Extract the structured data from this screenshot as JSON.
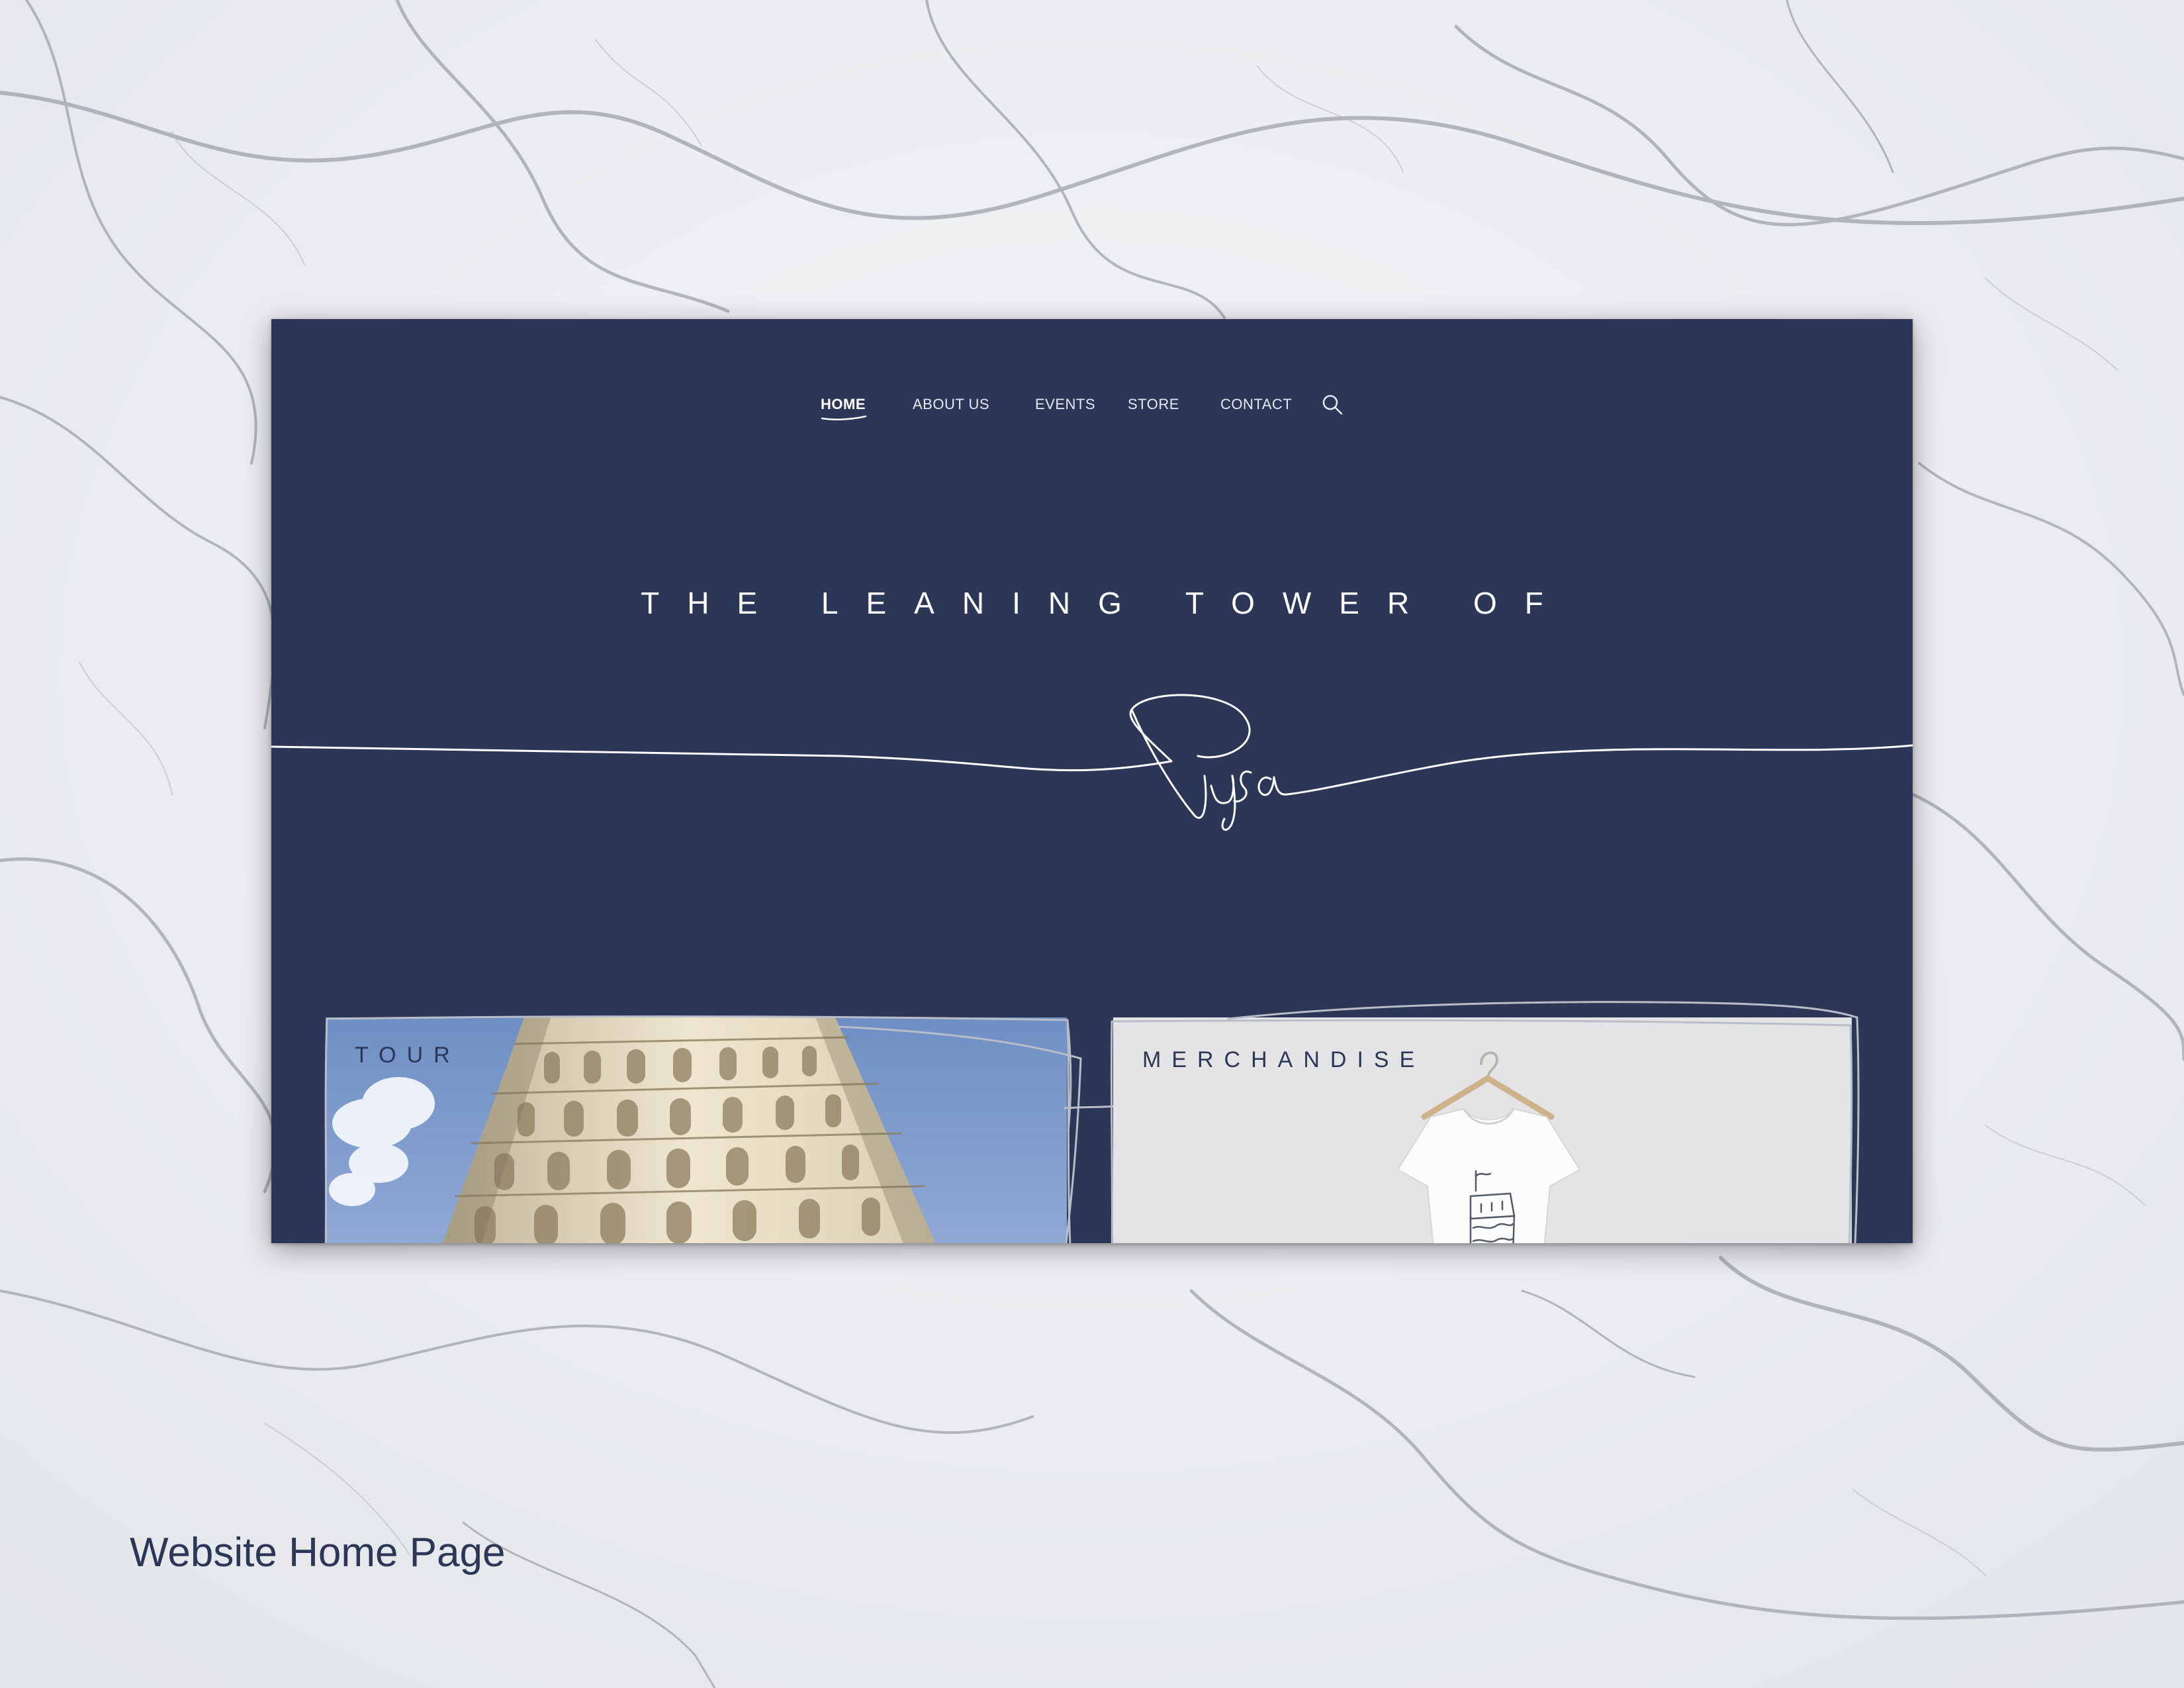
{
  "nav": {
    "items": [
      {
        "label": "HOME",
        "active": true
      },
      {
        "label": "ABOUT US",
        "active": false
      },
      {
        "label": "EVENTS",
        "active": false
      },
      {
        "label": "STORE",
        "active": false
      },
      {
        "label": "CONTACT",
        "active": false
      }
    ],
    "search_icon": "search-icon"
  },
  "hero": {
    "title": "THE LEANING TOWER OF",
    "script_word": "Pisa"
  },
  "cards": {
    "tour": {
      "label": "TOUR",
      "image": "leaning-tower-photo"
    },
    "merchandise": {
      "label": "MERCHANDISE",
      "image": "t-shirt-on-hanger"
    }
  },
  "caption": "Website Home Page",
  "colors": {
    "navy": "#2c3758",
    "marble": "#eef0f2",
    "merch_bg": "#e4e4e6",
    "sky": "#7d9ac8"
  }
}
